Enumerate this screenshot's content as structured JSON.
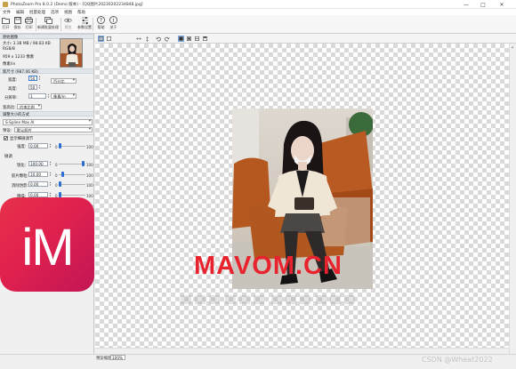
{
  "titlebar": {
    "title": "PhotoZoom Pro 8.0.2 (Demo 版本) - [QQ图片20230202234848.jpg]",
    "minimize": "—",
    "maximize": "□",
    "close": "✕"
  },
  "menu": [
    "文件",
    "编辑",
    "批量处理",
    "选项",
    "视图",
    "帮助"
  ],
  "toolbar": {
    "open": "打开",
    "save": "保存",
    "print": "打印",
    "new_batch": "新建批量处理",
    "preview": "预览",
    "settings": "参数设置",
    "help": "帮助",
    "about": "关于"
  },
  "left": {
    "original_header": "原始图像",
    "original_size": "大小: 3.38 MB / 98.83 KB",
    "color_mode": "RGB/8",
    "pixel_size": "959 x 1233 像素",
    "new_header": "新尺寸 (987.06 KB)",
    "width_label": "宽度:",
    "width_value": "50",
    "height_label": "高度:",
    "height_value": "50",
    "resolution_label": "分辨率:",
    "resolution_value": "1",
    "unit_percent": "百分比",
    "unit_px": "像素/in",
    "aspect_label": "宽高比:",
    "aspect_value": "约束比例",
    "method_header": "调整大小的方式",
    "method_value": "S-Spline Max AI",
    "preset_label": "预设:",
    "preset_value": "默认照片",
    "sharpen_checkbox": "显示细微调节",
    "strength_label": "强度:",
    "strength_value": "0.00",
    "fine_header": "微调",
    "sharpness_label": "锐化:",
    "sharpness_value": "100.00",
    "film_grain_label": "胶片颗粒:",
    "film_grain_value": "10.00",
    "jpeg_label": "消除伪影:",
    "jpeg_value": "0.00",
    "noise_label": "降噪:",
    "noise_value": "0.00",
    "detail_label": "清晰度:",
    "detail_value": "0.00",
    "extra_label": "增加纹理:",
    "extra_value": "0.00",
    "ai_label": "AI增强:",
    "ai_value": "一般",
    "resize_label": "调整大小到:",
    "tick_zero": "0",
    "tick_hundred": "100"
  },
  "status": {
    "zoom_label": "预览缩放:",
    "zoom_value": "100%"
  },
  "watermark": {
    "logo_text": "iM",
    "site_text": "MAVOM.CN",
    "csdn_text": "CSDN @Wheat2022"
  },
  "colors": {
    "accent": "#2d6fd0",
    "logo_red": "#e0214e",
    "watermark_red": "#e8232d"
  }
}
